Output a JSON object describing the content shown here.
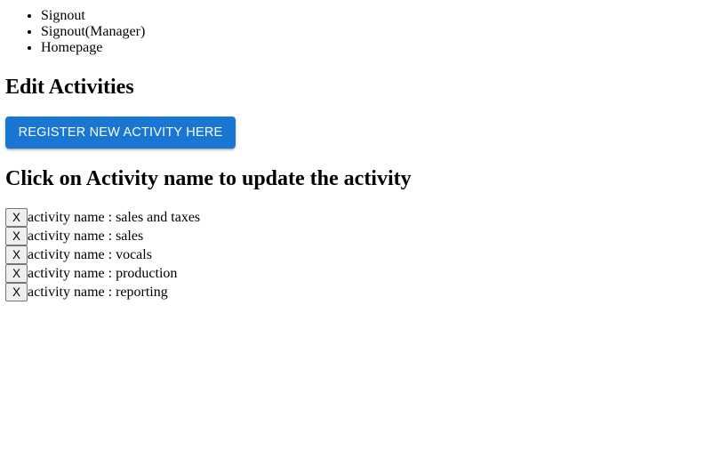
{
  "nav": {
    "items": [
      {
        "label": "Signout"
      },
      {
        "label": "Signout(Manager)"
      },
      {
        "label": "Homepage"
      }
    ]
  },
  "page": {
    "title": "Edit Activities",
    "register_button_label": "REGISTER NEW ACTIVITY HERE",
    "subtitle": "Click on Activity name to update the activity"
  },
  "activities": {
    "delete_label": "X",
    "items": [
      {
        "text": "activity name : sales and taxes"
      },
      {
        "text": "activity name : sales"
      },
      {
        "text": "activity name : vocals"
      },
      {
        "text": "activity name : production"
      },
      {
        "text": "activity name : reporting"
      }
    ]
  },
  "colors": {
    "accent": "#1976d2",
    "button_text": "#ffffff",
    "delete_button_bg": "#efefef",
    "delete_button_border": "#767676"
  }
}
